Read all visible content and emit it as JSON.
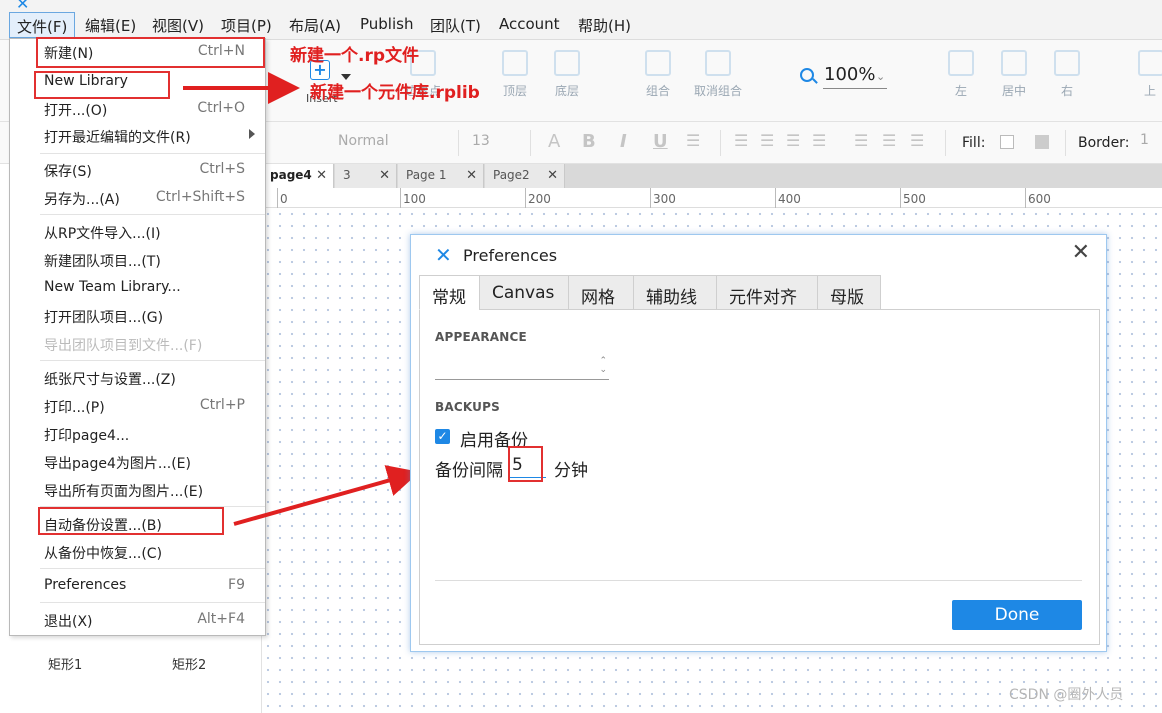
{
  "menubar": {
    "items": [
      "文件(F)",
      "编辑(E)",
      "视图(V)",
      "项目(P)",
      "布局(A)",
      "Publish",
      "团队(T)",
      "Account",
      "帮助(H)"
    ]
  },
  "toolbar": {
    "insert_label": "Insert",
    "partial_labels": [
      "边界点",
      "顶层",
      "底层",
      "组合",
      "取消组合",
      "左",
      "居中",
      "右",
      "上"
    ],
    "zoom": "100%"
  },
  "formatbar": {
    "style": "Normal",
    "size": "13",
    "fill_label": "Fill:",
    "border_label": "Border:",
    "border_value": "1"
  },
  "tabs": [
    {
      "label": "page4",
      "active": true
    },
    {
      "label": "3",
      "active": false
    },
    {
      "label": "Page 1",
      "active": false
    },
    {
      "label": "Page2",
      "active": false
    }
  ],
  "ruler": [
    "0",
    "100",
    "200",
    "300",
    "400",
    "500",
    "600"
  ],
  "leftpanel": {
    "shape1": "矩形1",
    "shape2": "矩形2"
  },
  "filemenu": {
    "items": [
      {
        "label": "新建(N)",
        "shortcut": "Ctrl+N"
      },
      {
        "label": "New Library",
        "shortcut": ""
      },
      {
        "label": "打开...(O)",
        "shortcut": "Ctrl+O"
      },
      {
        "label": "打开最近编辑的文件(R)",
        "shortcut": ""
      },
      {
        "label": "保存(S)",
        "shortcut": "Ctrl+S"
      },
      {
        "label": "另存为...(A)",
        "shortcut": "Ctrl+Shift+S"
      },
      {
        "label": "从RP文件导入...(I)",
        "shortcut": ""
      },
      {
        "label": "新建团队项目...(T)",
        "shortcut": ""
      },
      {
        "label": "New Team Library...",
        "shortcut": ""
      },
      {
        "label": "打开团队项目...(G)",
        "shortcut": ""
      },
      {
        "label": "导出团队项目到文件...(F)",
        "shortcut": ""
      },
      {
        "label": "纸张尺寸与设置...(Z)",
        "shortcut": ""
      },
      {
        "label": "打印...(P)",
        "shortcut": "Ctrl+P"
      },
      {
        "label": "打印page4...",
        "shortcut": ""
      },
      {
        "label": "导出page4为图片...(E)",
        "shortcut": ""
      },
      {
        "label": "导出所有页面为图片...(E)",
        "shortcut": ""
      },
      {
        "label": "自动备份设置...(B)",
        "shortcut": ""
      },
      {
        "label": "从备份中恢复...(C)",
        "shortcut": ""
      },
      {
        "label": "Preferences",
        "shortcut": "F9"
      },
      {
        "label": "退出(X)",
        "shortcut": "Alt+F4"
      }
    ]
  },
  "annotations": {
    "new_rp": "新建一个.rp文件",
    "new_rplib": "新建一个元件库.rplib"
  },
  "prefs": {
    "title": "Preferences",
    "tabs": [
      "常规",
      "Canvas",
      "网格",
      "辅助线",
      "元件对齐",
      "母版"
    ],
    "appearance_title": "APPEARANCE",
    "backups_title": "BACKUPS",
    "enable_backup": "启用备份",
    "interval_label": "备份间隔",
    "interval_value": "5",
    "interval_unit": "分钟",
    "done": "Done"
  },
  "watermark": "CSDN @圈外人员",
  "colors": {
    "accent": "#1e88e5",
    "annotation": "#e02020"
  }
}
